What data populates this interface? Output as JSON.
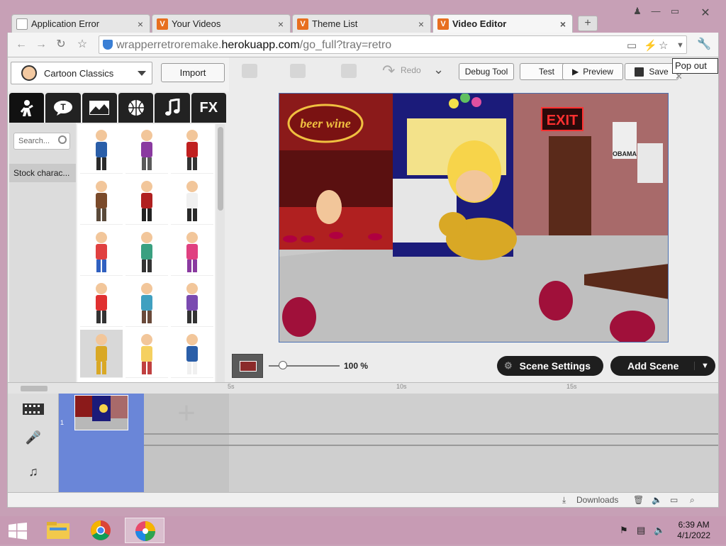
{
  "browser": {
    "tabs": [
      {
        "label": "Application Error",
        "favicon": "doc"
      },
      {
        "label": "Your Videos",
        "favicon": "V"
      },
      {
        "label": "Theme List",
        "favicon": "V"
      },
      {
        "label": "Video Editor",
        "favicon": "V",
        "active": true
      }
    ],
    "new_tab_label": "+",
    "url_dim": "wrapperretroremake.",
    "url_bold": "herokuapp.com",
    "url_rest": "/go_full?tray=retro"
  },
  "left_panel": {
    "theme_name": "Cartoon Classics",
    "import_label": "Import",
    "category_tabs": [
      "char",
      "speech",
      "background",
      "prop",
      "music",
      "FX"
    ],
    "fx_label": "FX",
    "search_placeholder": "Search...",
    "stock_label": "Stock charac..."
  },
  "editor": {
    "redo_label": "Redo",
    "debug_label": "Debug Tool",
    "test_label": "Test",
    "preview_label": "Preview",
    "save_label": "Save",
    "popout_label": "Pop out",
    "scene_sign_label": "beer wine",
    "exit_sign": "EXIT",
    "poster_text": "OBAMA",
    "zoom_value": "100 %",
    "zoom_level": 0.2,
    "scene_settings_label": "Scene Settings",
    "add_scene_label": "Add Scene"
  },
  "timeline": {
    "ruler_ticks": [
      "5s",
      "10s",
      "15s"
    ],
    "scene_number": "1"
  },
  "status": {
    "downloads_label": "Downloads"
  },
  "taskbar": {
    "time": "6:39 AM",
    "date": "4/1/2022"
  },
  "colors": {
    "accent_blue": "#6a86d8",
    "tab_black": "#1e1e1e",
    "stage_red": "#8b2a2a"
  }
}
